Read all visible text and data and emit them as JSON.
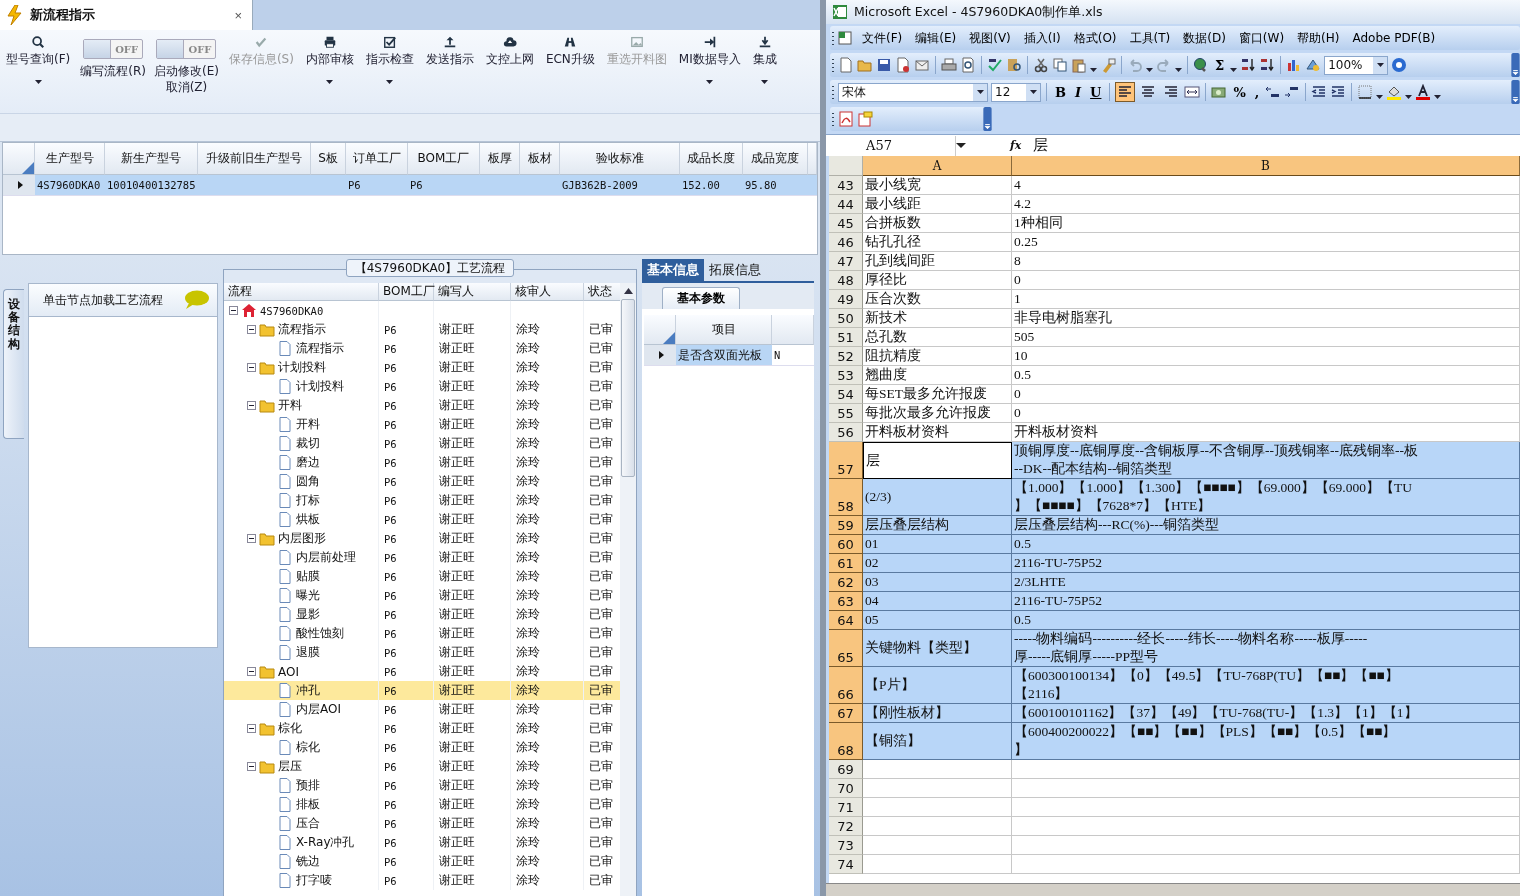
{
  "app_tab": {
    "title": "新流程指示",
    "close": "×"
  },
  "toolbar": [
    {
      "kind": "button",
      "label": [
        "型号查询(F)"
      ],
      "disabled": false,
      "dropdown": true
    },
    {
      "kind": "toggle",
      "toggle_text": "OFF",
      "on": false,
      "label": [
        "编写流程(R)"
      ]
    },
    {
      "kind": "toggle",
      "toggle_text": "OFF",
      "on": false,
      "label": [
        "启动修改(E)",
        "取消(Z)"
      ]
    },
    {
      "kind": "button",
      "label": [
        "保存信息(S)"
      ],
      "disabled": true,
      "dropdown": false
    },
    {
      "kind": "button",
      "label": [
        "内部审核"
      ],
      "disabled": false,
      "dropdown": true
    },
    {
      "kind": "button",
      "label": [
        "指示检查"
      ],
      "disabled": false,
      "dropdown": true
    },
    {
      "kind": "button",
      "label": [
        "发送指示"
      ],
      "disabled": false,
      "dropdown": false
    },
    {
      "kind": "button",
      "label": [
        "文控上网"
      ],
      "disabled": false,
      "dropdown": false
    },
    {
      "kind": "button",
      "label": [
        "ECN升级"
      ],
      "disabled": false,
      "dropdown": false
    },
    {
      "kind": "button",
      "label": [
        "重选开料图"
      ],
      "disabled": true,
      "dropdown": false
    },
    {
      "kind": "button",
      "label": [
        "MI数据导入"
      ],
      "disabled": false,
      "dropdown": true
    },
    {
      "kind": "button",
      "label": [
        "集成"
      ],
      "disabled": false,
      "dropdown": true
    }
  ],
  "product_grid": {
    "columns": [
      "生产型号",
      "新生产型号",
      "升级前旧生产型号",
      "S板",
      "订单工厂",
      "BOM工厂",
      "板厚",
      "板材",
      "验收标准",
      "成品长度",
      "成品宽度"
    ],
    "rows": [
      {
        "selected": true,
        "cells": [
          "4S7960DKA0",
          "10010400132785",
          null,
          null,
          "P6",
          "P6",
          null,
          null,
          "GJB362B-2009",
          "152.00",
          "95.80"
        ]
      }
    ]
  },
  "side_tab": {
    "label": "设备结构"
  },
  "node_panel": {
    "hint": "单击节点加载工艺流程"
  },
  "flow_group": {
    "title": "【4S7960DKA0】工艺流程",
    "columns": [
      "流程",
      "BOM工厂",
      "编写人",
      "核审人",
      "状态"
    ],
    "tree": [
      {
        "label": "4S7960DKA0",
        "kind": "root",
        "expanded": true,
        "selected": false,
        "children": [
          {
            "label": "流程指示",
            "kind": "folder",
            "expanded": true,
            "selected": false,
            "bom": "P6",
            "writer": "谢正旺",
            "reviewer": "涂玲",
            "status": "已审",
            "children": [
              {
                "label": "流程指示",
                "kind": "doc",
                "selected": false,
                "bom": "P6",
                "writer": "谢正旺",
                "reviewer": "涂玲",
                "status": "已审"
              }
            ]
          },
          {
            "label": "计划投料",
            "kind": "folder",
            "expanded": true,
            "selected": false,
            "bom": "P6",
            "writer": "谢正旺",
            "reviewer": "涂玲",
            "status": "已审",
            "children": [
              {
                "label": "计划投料",
                "kind": "doc",
                "selected": false,
                "bom": "P6",
                "writer": "谢正旺",
                "reviewer": "涂玲",
                "status": "已审"
              }
            ]
          },
          {
            "label": "开料",
            "kind": "folder",
            "expanded": true,
            "selected": false,
            "bom": "P6",
            "writer": "谢正旺",
            "reviewer": "涂玲",
            "status": "已审",
            "children": [
              {
                "label": "开料",
                "kind": "doc",
                "selected": false,
                "bom": "P6",
                "writer": "谢正旺",
                "reviewer": "涂玲",
                "status": "已审"
              },
              {
                "label": "裁切",
                "kind": "doc",
                "selected": false,
                "bom": "P6",
                "writer": "谢正旺",
                "reviewer": "涂玲",
                "status": "已审"
              },
              {
                "label": "磨边",
                "kind": "doc",
                "selected": false,
                "bom": "P6",
                "writer": "谢正旺",
                "reviewer": "涂玲",
                "status": "已审"
              },
              {
                "label": "圆角",
                "kind": "doc",
                "selected": false,
                "bom": "P6",
                "writer": "谢正旺",
                "reviewer": "涂玲",
                "status": "已审"
              },
              {
                "label": "打标",
                "kind": "doc",
                "selected": false,
                "bom": "P6",
                "writer": "谢正旺",
                "reviewer": "涂玲",
                "status": "已审"
              },
              {
                "label": "烘板",
                "kind": "doc",
                "selected": false,
                "bom": "P6",
                "writer": "谢正旺",
                "reviewer": "涂玲",
                "status": "已审"
              }
            ]
          },
          {
            "label": "内层图形",
            "kind": "folder",
            "expanded": true,
            "selected": false,
            "bom": "P6",
            "writer": "谢正旺",
            "reviewer": "涂玲",
            "status": "已审",
            "children": [
              {
                "label": "内层前处理",
                "kind": "doc",
                "selected": false,
                "bom": "P6",
                "writer": "谢正旺",
                "reviewer": "涂玲",
                "status": "已审"
              },
              {
                "label": "贴膜",
                "kind": "doc",
                "selected": false,
                "bom": "P6",
                "writer": "谢正旺",
                "reviewer": "涂玲",
                "status": "已审"
              },
              {
                "label": "曝光",
                "kind": "doc",
                "selected": false,
                "bom": "P6",
                "writer": "谢正旺",
                "reviewer": "涂玲",
                "status": "已审"
              },
              {
                "label": "显影",
                "kind": "doc",
                "selected": false,
                "bom": "P6",
                "writer": "谢正旺",
                "reviewer": "涂玲",
                "status": "已审"
              },
              {
                "label": "酸性蚀刻",
                "kind": "doc",
                "selected": false,
                "bom": "P6",
                "writer": "谢正旺",
                "reviewer": "涂玲",
                "status": "已审"
              },
              {
                "label": "退膜",
                "kind": "doc",
                "selected": false,
                "bom": "P6",
                "writer": "谢正旺",
                "reviewer": "涂玲",
                "status": "已审"
              }
            ]
          },
          {
            "label": "AOI",
            "kind": "folder",
            "expanded": true,
            "selected": false,
            "bom": "P6",
            "writer": "谢正旺",
            "reviewer": "涂玲",
            "status": "已审",
            "children": [
              {
                "label": "冲孔",
                "kind": "doc",
                "selected": true,
                "bom": "P6",
                "writer": "谢正旺",
                "reviewer": "涂玲",
                "status": "已审"
              },
              {
                "label": "内层AOI",
                "kind": "doc",
                "selected": false,
                "bom": "P6",
                "writer": "谢正旺",
                "reviewer": "涂玲",
                "status": "已审"
              }
            ]
          },
          {
            "label": "棕化",
            "kind": "folder",
            "expanded": true,
            "selected": false,
            "bom": "P6",
            "writer": "谢正旺",
            "reviewer": "涂玲",
            "status": "已审",
            "children": [
              {
                "label": "棕化",
                "kind": "doc",
                "selected": false,
                "bom": "P6",
                "writer": "谢正旺",
                "reviewer": "涂玲",
                "status": "已审"
              }
            ]
          },
          {
            "label": "层压",
            "kind": "folder",
            "expanded": true,
            "selected": false,
            "bom": "P6",
            "writer": "谢正旺",
            "reviewer": "涂玲",
            "status": "已审",
            "children": [
              {
                "label": "预排",
                "kind": "doc",
                "selected": false,
                "bom": "P6",
                "writer": "谢正旺",
                "reviewer": "涂玲",
                "status": "已审"
              },
              {
                "label": "排板",
                "kind": "doc",
                "selected": false,
                "bom": "P6",
                "writer": "谢正旺",
                "reviewer": "涂玲",
                "status": "已审"
              },
              {
                "label": "压合",
                "kind": "doc",
                "selected": false,
                "bom": "P6",
                "writer": "谢正旺",
                "reviewer": "涂玲",
                "status": "已审"
              },
              {
                "label": "X-Ray冲孔",
                "kind": "doc",
                "selected": false,
                "bom": "P6",
                "writer": "谢正旺",
                "reviewer": "涂玲",
                "status": "已审"
              },
              {
                "label": "铣边",
                "kind": "doc",
                "selected": false,
                "bom": "P6",
                "writer": "谢正旺",
                "reviewer": "涂玲",
                "status": "已审"
              },
              {
                "label": "打字唛",
                "kind": "doc",
                "selected": false,
                "bom": "P6",
                "writer": "谢正旺",
                "reviewer": "涂玲",
                "status": "已审"
              }
            ]
          }
        ]
      }
    ]
  },
  "info_panel": {
    "tabs": [
      {
        "label": "基本信息",
        "selected": true
      },
      {
        "label": "拓展信息",
        "selected": false
      }
    ],
    "subtabs": [
      {
        "label": "基本参数",
        "selected": true
      }
    ],
    "columns": [
      "项目"
    ],
    "rows": [
      {
        "selected": true,
        "cells": [
          "是否含双面光板",
          "N"
        ]
      }
    ]
  },
  "excel": {
    "title": "Microsoft Excel - 4S7960DKA0制作单.xls",
    "menu": [
      "文件(F)",
      "编辑(E)",
      "视图(V)",
      "插入(I)",
      "格式(O)",
      "工具(T)",
      "数据(D)",
      "窗口(W)",
      "帮助(H)",
      "Adobe PDF(B)"
    ],
    "sigma": "Σ",
    "zoom": "100%",
    "font": "宋体",
    "font_size": "12",
    "style_buttons": [
      "B",
      "I",
      "U"
    ],
    "align_buttons": [
      {
        "selected": true
      },
      {
        "selected": false
      },
      {
        "selected": false
      }
    ],
    "number_buttons": [
      "%",
      ","
    ],
    "name_box": "A57",
    "formula_label": "fx",
    "formula": "层",
    "columns": [
      {
        "label": "A",
        "selected": true
      },
      {
        "label": "B",
        "selected": true
      }
    ],
    "rows": [
      {
        "num": "43",
        "selected": false,
        "active": false,
        "a": [
          "最小线宽"
        ],
        "b": [
          "4"
        ]
      },
      {
        "num": "44",
        "selected": false,
        "active": false,
        "a": [
          "最小线距"
        ],
        "b": [
          "4.2"
        ]
      },
      {
        "num": "45",
        "selected": false,
        "active": false,
        "a": [
          "合拼板数"
        ],
        "b": [
          "1种相同"
        ]
      },
      {
        "num": "46",
        "selected": false,
        "active": false,
        "a": [
          "钻孔孔径"
        ],
        "b": [
          "0.25"
        ]
      },
      {
        "num": "47",
        "selected": false,
        "active": false,
        "a": [
          "孔到线间距"
        ],
        "b": [
          "8"
        ]
      },
      {
        "num": "48",
        "selected": false,
        "active": false,
        "a": [
          "厚径比"
        ],
        "b": [
          "0"
        ]
      },
      {
        "num": "49",
        "selected": false,
        "active": false,
        "a": [
          "压合次数"
        ],
        "b": [
          "1"
        ]
      },
      {
        "num": "50",
        "selected": false,
        "active": false,
        "a": [
          "新技术"
        ],
        "b": [
          "非导电树脂塞孔"
        ]
      },
      {
        "num": "51",
        "selected": false,
        "active": false,
        "a": [
          "总孔数"
        ],
        "b": [
          "505"
        ]
      },
      {
        "num": "52",
        "selected": false,
        "active": false,
        "a": [
          "阻抗精度"
        ],
        "b": [
          "10"
        ]
      },
      {
        "num": "53",
        "selected": false,
        "active": false,
        "a": [
          "翘曲度"
        ],
        "b": [
          "0.5"
        ]
      },
      {
        "num": "54",
        "selected": false,
        "active": false,
        "a": [
          "每SET最多允许报废"
        ],
        "b": [
          "0"
        ]
      },
      {
        "num": "55",
        "selected": false,
        "active": false,
        "a": [
          "每批次最多允许报废"
        ],
        "b": [
          "0"
        ]
      },
      {
        "num": "56",
        "selected": false,
        "active": false,
        "a": [
          "开料板材资料"
        ],
        "b": [
          "开料板材资料"
        ]
      },
      {
        "num": "57",
        "selected": true,
        "active": true,
        "a": [
          "层"
        ],
        "b": [
          "顶铜厚度--底铜厚度--含铜板厚--不含铜厚--顶残铜率--底残铜率--板",
          "--DK--配本结构--铜箔类型"
        ]
      },
      {
        "num": "58",
        "selected": true,
        "active": false,
        "a": [
          "(2/3)"
        ],
        "b": [
          "【1.000】【1.000】【1.300】【■■■■】【69.000】【69.000】【TU",
          "】【■■■■】【7628*7】【HTE】"
        ]
      },
      {
        "num": "59",
        "selected": true,
        "active": false,
        "a": [
          "层压叠层结构"
        ],
        "b": [
          "层压叠层结构---RC(%)---铜箔类型"
        ]
      },
      {
        "num": "60",
        "selected": true,
        "active": false,
        "a": [
          "01"
        ],
        "b": [
          "0.5"
        ]
      },
      {
        "num": "61",
        "selected": true,
        "active": false,
        "a": [
          "02"
        ],
        "b": [
          "2116-TU-75P52"
        ]
      },
      {
        "num": "62",
        "selected": true,
        "active": false,
        "a": [
          "03"
        ],
        "b": [
          "2/3LHTE"
        ]
      },
      {
        "num": "63",
        "selected": true,
        "active": false,
        "a": [
          "04"
        ],
        "b": [
          "2116-TU-75P52"
        ]
      },
      {
        "num": "64",
        "selected": true,
        "active": false,
        "a": [
          "05"
        ],
        "b": [
          "0.5"
        ]
      },
      {
        "num": "65",
        "selected": true,
        "active": false,
        "a": [
          "关键物料【类型】"
        ],
        "b": [
          "-----物料编码----------经长-----纬长-----物料名称-----板厚-----",
          "厚-----底铜厚-----PP型号"
        ]
      },
      {
        "num": "66",
        "selected": true,
        "active": false,
        "a": [
          "【P片】"
        ],
        "b": [
          "【600300100134】【0】【49.5】【TU-768P(TU】【■■】【■■】",
          "【2116】"
        ]
      },
      {
        "num": "67",
        "selected": true,
        "active": false,
        "a": [
          "【刚性板材】"
        ],
        "b": [
          "【600100101162】【37】【49】【TU-768(TU-】【1.3】【1】【1】"
        ]
      },
      {
        "num": "68",
        "selected": true,
        "active": false,
        "a": [
          "【铜箔】"
        ],
        "b": [
          "【600400200022】【■■】【■■】【PLS】【■■】【0.5】【■■】",
          "】"
        ]
      },
      {
        "num": "69",
        "selected": false,
        "active": false
      },
      {
        "num": "70",
        "selected": false,
        "active": false
      },
      {
        "num": "71",
        "selected": false,
        "active": false
      },
      {
        "num": "72",
        "selected": false,
        "active": false
      },
      {
        "num": "73",
        "selected": false,
        "active": false
      },
      {
        "num": "74",
        "selected": false,
        "active": false
      }
    ]
  }
}
